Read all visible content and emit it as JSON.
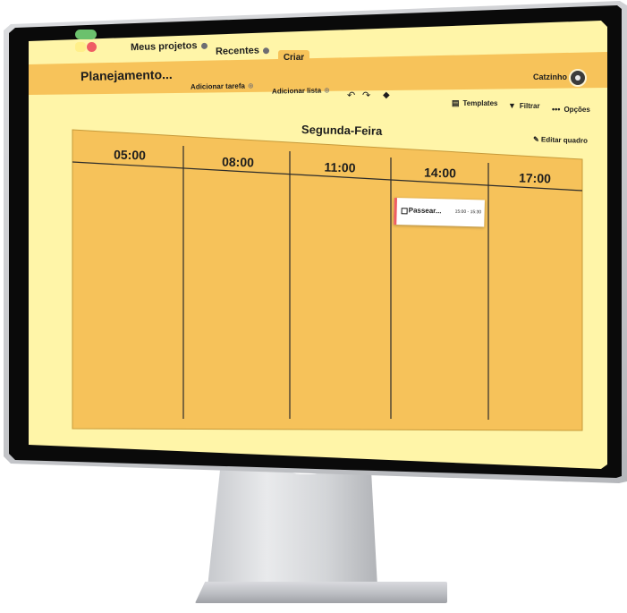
{
  "nav": {
    "my_projects": "Meus projetos",
    "recent": "Recentes",
    "create": "Criar"
  },
  "user": {
    "name": "Catzinho"
  },
  "toolbar": {
    "board_title": "Planejamento...",
    "add_task": "Adicionar tarefa",
    "add_list": "Adicionar lista",
    "templates": "Templates",
    "filter": "Filtrar",
    "options": "Opções"
  },
  "board": {
    "day": "Segunda-Feira",
    "edit": "Editar quadro",
    "columns": [
      "05:00",
      "08:00",
      "11:00",
      "14:00",
      "17:00"
    ]
  },
  "task": {
    "name": "Passear...",
    "time": "15:00 - 15:30",
    "color": "#ef5d64"
  },
  "colors": {
    "screen_background": "#fff5a8",
    "toolbar": "#f7c35a",
    "board": "#f6c25a",
    "accent_green": "#6cc16d",
    "accent_red": "#ef5d64"
  },
  "icons": {
    "undo": "undo-icon",
    "redo": "redo-icon",
    "eraser": "eraser-icon",
    "templates": "templates-icon",
    "filter": "filter-icon",
    "options": "more-icon",
    "edit": "pencil-icon"
  }
}
